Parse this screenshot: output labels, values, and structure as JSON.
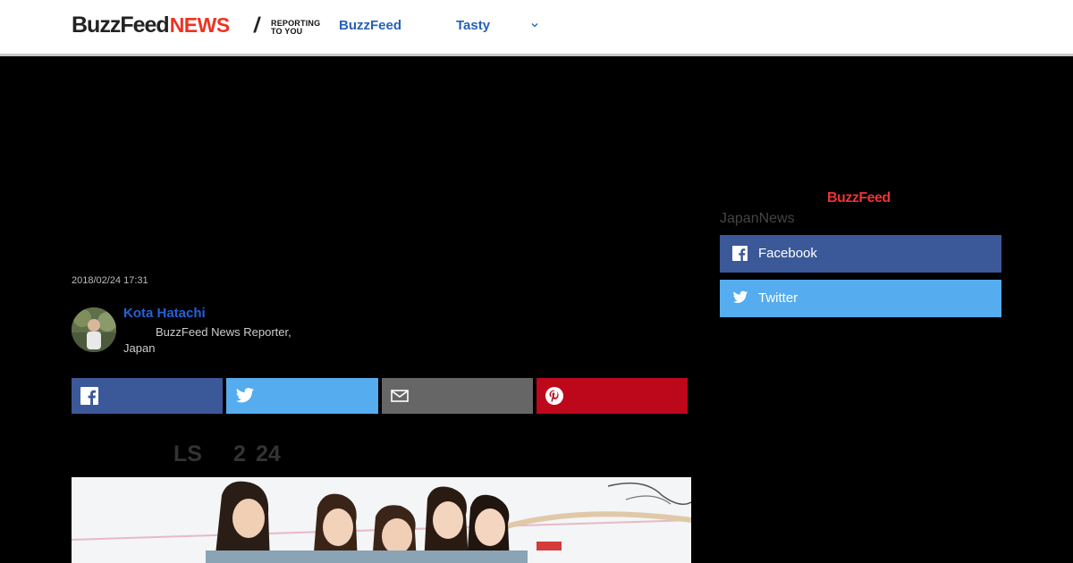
{
  "header": {
    "logo_buzzfeed": "BuzzFeed",
    "logo_news": "NEWS",
    "slash": "/",
    "tagline_line1": "REPORTING",
    "tagline_line2": "TO YOU",
    "nav": [
      {
        "label": "BuzzFeed"
      },
      {
        "label": "Tasty"
      }
    ]
  },
  "article": {
    "date": "2018/02/24 17:31",
    "author": {
      "name": "Kota Hatachi",
      "title": "BuzzFeed News Reporter,",
      "location": "Japan"
    },
    "share": [
      {
        "network": "facebook",
        "icon": "facebook-icon",
        "color": "#3b5998"
      },
      {
        "network": "twitter",
        "icon": "twitter-icon",
        "color": "#55acee"
      },
      {
        "network": "email",
        "icon": "mail-icon",
        "color": "#666666"
      },
      {
        "network": "pinterest",
        "icon": "pinterest-icon",
        "color": "#bd081c"
      }
    ],
    "headline_fragments": [
      "LS",
      "2",
      "24"
    ]
  },
  "sidebar": {
    "logo": "BuzzFeed",
    "label": "JapanNews",
    "buttons": [
      {
        "label": "Facebook",
        "icon": "facebook-icon",
        "color": "#3b5998"
      },
      {
        "label": "Twitter",
        "icon": "twitter-icon",
        "color": "#55acee"
      }
    ]
  },
  "colors": {
    "accent_blue": "#2561b8",
    "brand_red": "#ee3322",
    "background": "#000000"
  }
}
